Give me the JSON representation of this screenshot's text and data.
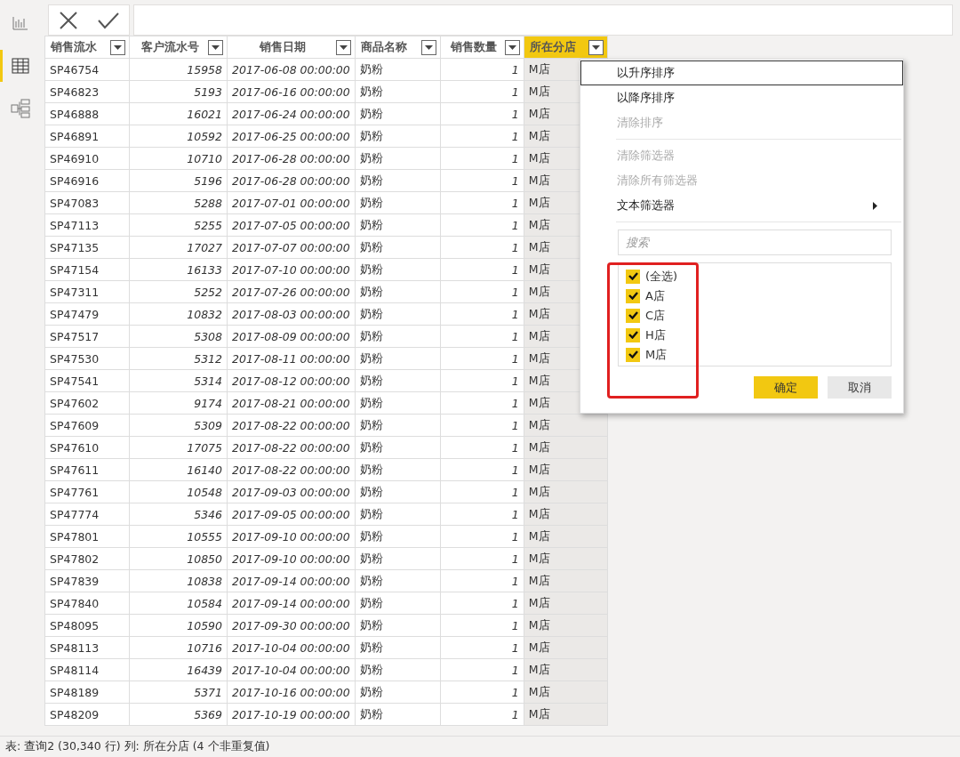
{
  "rail": {
    "items": [
      {
        "kind": "report",
        "selected": false
      },
      {
        "kind": "data",
        "selected": true
      },
      {
        "kind": "model",
        "selected": false
      }
    ]
  },
  "table": {
    "columns": [
      {
        "label": "销售流水",
        "kind": "text",
        "selected": false
      },
      {
        "label": "客户流水号",
        "kind": "number",
        "selected": false
      },
      {
        "label": "销售日期",
        "kind": "number",
        "selected": false
      },
      {
        "label": "商品名称",
        "kind": "text",
        "selected": false
      },
      {
        "label": "销售数量",
        "kind": "number",
        "selected": false
      },
      {
        "label": "所在分店",
        "kind": "text",
        "selected": true
      }
    ],
    "rows": [
      [
        "SP46754",
        "15958",
        "2017-06-08 00:00:00",
        "奶粉",
        "1",
        "M店"
      ],
      [
        "SP46823",
        "5193",
        "2017-06-16 00:00:00",
        "奶粉",
        "1",
        "M店"
      ],
      [
        "SP46888",
        "16021",
        "2017-06-24 00:00:00",
        "奶粉",
        "1",
        "M店"
      ],
      [
        "SP46891",
        "10592",
        "2017-06-25 00:00:00",
        "奶粉",
        "1",
        "M店"
      ],
      [
        "SP46910",
        "10710",
        "2017-06-28 00:00:00",
        "奶粉",
        "1",
        "M店"
      ],
      [
        "SP46916",
        "5196",
        "2017-06-28 00:00:00",
        "奶粉",
        "1",
        "M店"
      ],
      [
        "SP47083",
        "5288",
        "2017-07-01 00:00:00",
        "奶粉",
        "1",
        "M店"
      ],
      [
        "SP47113",
        "5255",
        "2017-07-05 00:00:00",
        "奶粉",
        "1",
        "M店"
      ],
      [
        "SP47135",
        "17027",
        "2017-07-07 00:00:00",
        "奶粉",
        "1",
        "M店"
      ],
      [
        "SP47154",
        "16133",
        "2017-07-10 00:00:00",
        "奶粉",
        "1",
        "M店"
      ],
      [
        "SP47311",
        "5252",
        "2017-07-26 00:00:00",
        "奶粉",
        "1",
        "M店"
      ],
      [
        "SP47479",
        "10832",
        "2017-08-03 00:00:00",
        "奶粉",
        "1",
        "M店"
      ],
      [
        "SP47517",
        "5308",
        "2017-08-09 00:00:00",
        "奶粉",
        "1",
        "M店"
      ],
      [
        "SP47530",
        "5312",
        "2017-08-11 00:00:00",
        "奶粉",
        "1",
        "M店"
      ],
      [
        "SP47541",
        "5314",
        "2017-08-12 00:00:00",
        "奶粉",
        "1",
        "M店"
      ],
      [
        "SP47602",
        "9174",
        "2017-08-21 00:00:00",
        "奶粉",
        "1",
        "M店"
      ],
      [
        "SP47609",
        "5309",
        "2017-08-22 00:00:00",
        "奶粉",
        "1",
        "M店"
      ],
      [
        "SP47610",
        "17075",
        "2017-08-22 00:00:00",
        "奶粉",
        "1",
        "M店"
      ],
      [
        "SP47611",
        "16140",
        "2017-08-22 00:00:00",
        "奶粉",
        "1",
        "M店"
      ],
      [
        "SP47761",
        "10548",
        "2017-09-03 00:00:00",
        "奶粉",
        "1",
        "M店"
      ],
      [
        "SP47774",
        "5346",
        "2017-09-05 00:00:00",
        "奶粉",
        "1",
        "M店"
      ],
      [
        "SP47801",
        "10555",
        "2017-09-10 00:00:00",
        "奶粉",
        "1",
        "M店"
      ],
      [
        "SP47802",
        "10850",
        "2017-09-10 00:00:00",
        "奶粉",
        "1",
        "M店"
      ],
      [
        "SP47839",
        "10838",
        "2017-09-14 00:00:00",
        "奶粉",
        "1",
        "M店"
      ],
      [
        "SP47840",
        "10584",
        "2017-09-14 00:00:00",
        "奶粉",
        "1",
        "M店"
      ],
      [
        "SP48095",
        "10590",
        "2017-09-30 00:00:00",
        "奶粉",
        "1",
        "M店"
      ],
      [
        "SP48113",
        "10716",
        "2017-10-04 00:00:00",
        "奶粉",
        "1",
        "M店"
      ],
      [
        "SP48114",
        "16439",
        "2017-10-04 00:00:00",
        "奶粉",
        "1",
        "M店"
      ],
      [
        "SP48189",
        "5371",
        "2017-10-16 00:00:00",
        "奶粉",
        "1",
        "M店"
      ],
      [
        "SP48209",
        "5369",
        "2017-10-19 00:00:00",
        "奶粉",
        "1",
        "M店"
      ]
    ]
  },
  "filter_menu": {
    "items": [
      {
        "kind": "item",
        "label": "以升序排序",
        "disabled": false,
        "selected": true
      },
      {
        "kind": "item",
        "label": "以降序排序",
        "disabled": false,
        "selected": false
      },
      {
        "kind": "item",
        "label": "清除排序",
        "disabled": true,
        "selected": false
      },
      {
        "kind": "divider"
      },
      {
        "kind": "item",
        "label": "清除筛选器",
        "disabled": true,
        "selected": false
      },
      {
        "kind": "item",
        "label": "清除所有筛选器",
        "disabled": true,
        "selected": false
      },
      {
        "kind": "submenu",
        "label": "文本筛选器",
        "disabled": false,
        "selected": false
      },
      {
        "kind": "divider"
      }
    ],
    "search": {
      "placeholder": "搜索"
    },
    "options": [
      {
        "label": "(全选)",
        "checked": true
      },
      {
        "label": "A店",
        "checked": true
      },
      {
        "label": "C店",
        "checked": true
      },
      {
        "label": "H店",
        "checked": true
      },
      {
        "label": "M店",
        "checked": true
      }
    ],
    "buttons": [
      {
        "label": "确定",
        "kind": "primary"
      },
      {
        "label": "取消",
        "kind": "secondary"
      }
    ]
  },
  "status_bar": "表: 查询2 (30,340 行) 列: 所在分店 (4 个非重复值)"
}
